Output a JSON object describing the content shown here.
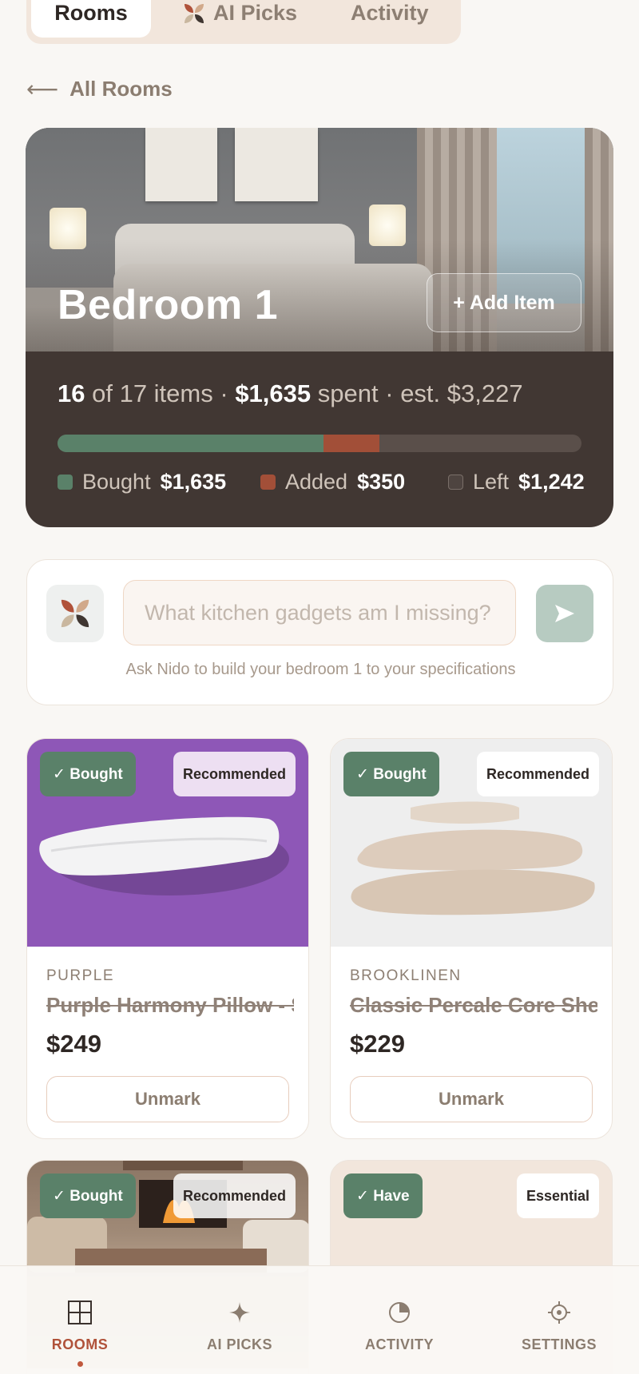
{
  "top_tabs": {
    "rooms": "Rooms",
    "ai_picks": "AI Picks",
    "activity": "Activity"
  },
  "back": {
    "arrow": "⟵",
    "label": "All Rooms"
  },
  "room": {
    "title": "Bedroom 1",
    "add_item": "+ Add Item",
    "items_bought": "16",
    "items_text": "of 17 items",
    "sep1": "·",
    "spent": "$1,635",
    "spent_text": "spent",
    "sep2": "·",
    "estimate": "est. $3,227",
    "progress": {
      "bought_fraction": 0.507,
      "added_fraction": 0.108
    },
    "legend": [
      {
        "label": "Bought",
        "value": "$1,635",
        "color": "#5a8169"
      },
      {
        "label": "Added",
        "value": "$350",
        "color": "#a24f38"
      },
      {
        "label": "Left",
        "value": "$1,242",
        "color": "#4e4440"
      }
    ]
  },
  "ask": {
    "placeholder": "What kitchen gadgets am I missing?",
    "hint": "Ask Nido to build your bedroom 1 to your specifications"
  },
  "products": [
    {
      "status": "✓ Bought",
      "tag": "Recommended",
      "brand": "PURPLE",
      "name": "Purple Harmony Pillow - Standard",
      "price": "$249",
      "action": "Unmark"
    },
    {
      "status": "✓ Bought",
      "tag": "Recommended",
      "brand": "BROOKLINEN",
      "name": "Classic Percale Core Sheet Set",
      "price": "$229",
      "action": "Unmark"
    },
    {
      "status": "✓ Bought",
      "tag": "Recommended"
    },
    {
      "status": "✓ Have",
      "tag": "Essential"
    }
  ],
  "nav": [
    {
      "label": "ROOMS",
      "icon": "grid-icon"
    },
    {
      "label": "AI PICKS",
      "icon": "sparkle-icon"
    },
    {
      "label": "ACTIVITY",
      "icon": "pie-icon"
    },
    {
      "label": "SETTINGS",
      "icon": "gear-icon"
    }
  ],
  "colors": {
    "accent": "#b0523a",
    "green": "#5a8169",
    "dark": "#413733"
  }
}
